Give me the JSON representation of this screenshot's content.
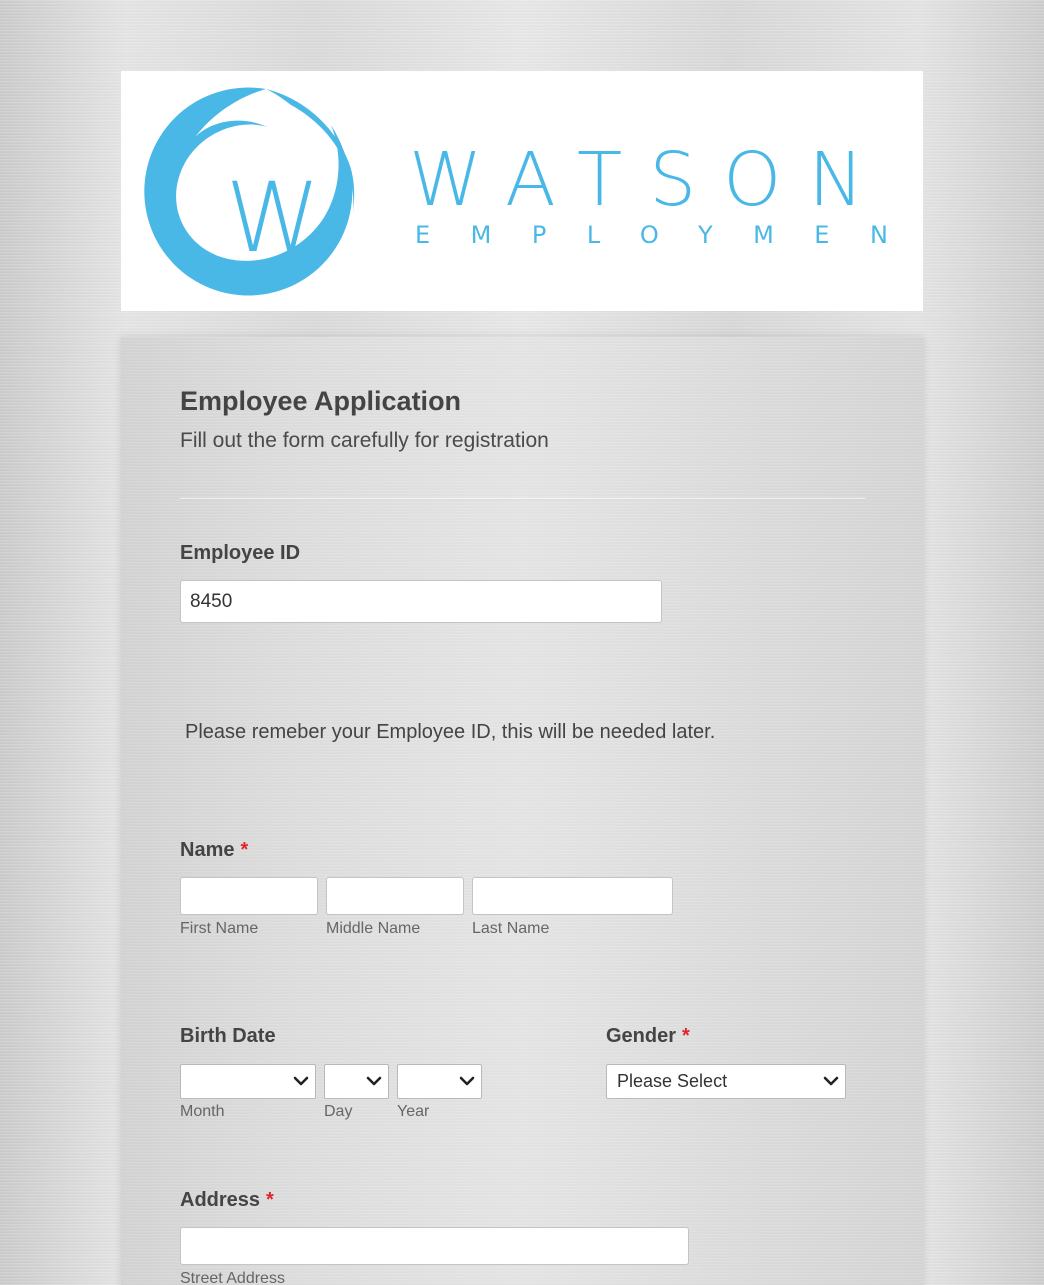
{
  "header": {
    "logo_letter": "W",
    "brand_name": "WATSON",
    "brand_sub": "EMPLOYMENT",
    "brand_color": "#4ab8e6"
  },
  "form": {
    "title": "Employee Application",
    "subtitle": "Fill out the form carefully for registration",
    "employee_id": {
      "label": "Employee ID",
      "value": "8450"
    },
    "note": "Please remeber your Employee ID, this will be needed later.",
    "name": {
      "label": "Name",
      "required_mark": "*",
      "first_label": "First Name",
      "middle_label": "Middle Name",
      "last_label": "Last Name",
      "first_value": "",
      "middle_value": "",
      "last_value": ""
    },
    "birth_date": {
      "label": "Birth Date",
      "month_label": "Month",
      "day_label": "Day",
      "year_label": "Year",
      "month_value": "",
      "day_value": "",
      "year_value": ""
    },
    "gender": {
      "label": "Gender",
      "required_mark": "*",
      "selected": "Please Select"
    },
    "address": {
      "label": "Address",
      "required_mark": "*",
      "street_label": "Street Address",
      "street_value": ""
    }
  },
  "icons": {
    "select_arrow": "chevron-down-icon"
  },
  "colors": {
    "required": "#e0262c",
    "text": "#444444"
  }
}
